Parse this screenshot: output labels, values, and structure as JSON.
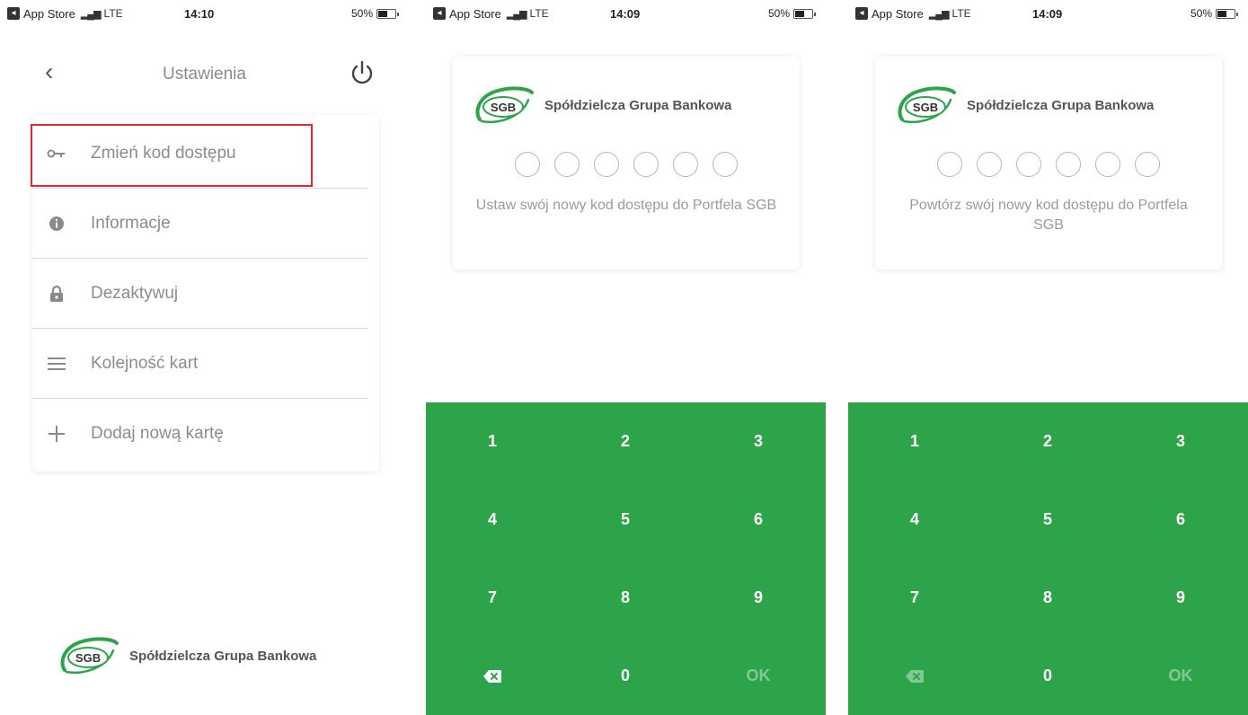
{
  "status_bars": [
    {
      "carrier": "App Store",
      "network": "LTE",
      "time": "14:10",
      "battery": "50%"
    },
    {
      "carrier": "App Store",
      "network": "LTE",
      "time": "14:09",
      "battery": "50%"
    },
    {
      "carrier": "App Store",
      "network": "LTE",
      "time": "14:09",
      "battery": "50%"
    }
  ],
  "settings": {
    "title": "Ustawienia",
    "items": [
      {
        "label": "Zmień kod dostępu",
        "icon": "key-icon"
      },
      {
        "label": "Informacje",
        "icon": "info-icon"
      },
      {
        "label": "Dezaktywuj",
        "icon": "lock-icon"
      },
      {
        "label": "Kolejność kart",
        "icon": "menu-lines-icon"
      },
      {
        "label": "Dodaj nową kartę",
        "icon": "plus-icon"
      }
    ],
    "highlighted_item": "Zmień kod dostępu"
  },
  "brand": {
    "logo_text": "SGB",
    "bank_name": "Spółdzielcza Grupa Bankowa"
  },
  "set_code": {
    "prompt": "Ustaw swój nowy kod dostępu do Portfela SGB"
  },
  "repeat_code": {
    "prompt": "Powtórz swój nowy kod dostępu do Portfela SGB"
  },
  "keypad": {
    "keys": [
      "1",
      "2",
      "3",
      "4",
      "5",
      "6",
      "7",
      "8",
      "9",
      "",
      "0",
      "OK"
    ],
    "ok_label": "OK"
  },
  "colors": {
    "keypad_green": "#2ea44a",
    "highlight_red": "#e0282d",
    "logo_green": "#2ea44a"
  }
}
